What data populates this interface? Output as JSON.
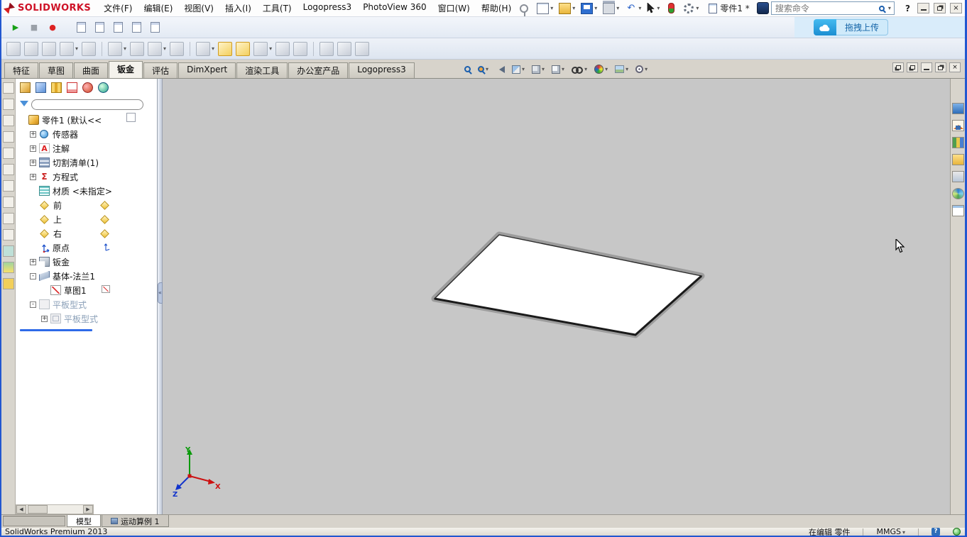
{
  "icons": {
    "dropdown": "▾",
    "help": "?",
    "close": "×",
    "play": "▶",
    "stop": "■",
    "record": "●",
    "undo": "↶",
    "scroll_left": "◀",
    "scroll_right": "▶",
    "splitter_left": "«",
    "annotation_glyph": "A",
    "sigma": "Σ"
  },
  "menubar": {
    "logo": "SOLIDWORKS",
    "menus": [
      "文件(F)",
      "编辑(E)",
      "视图(V)",
      "插入(I)",
      "工具(T)",
      "Logopress3",
      "PhotoView 360",
      "窗口(W)",
      "帮助(H)"
    ],
    "doc_title": "零件1 *",
    "search_placeholder": "搜索命令"
  },
  "macro_bar": {
    "upload_label": "拖拽上传"
  },
  "toolbar_icons": {
    "quick": [
      "new-document",
      "open-document",
      "save-document",
      "print-document",
      "undo",
      "select-cursor",
      "rebuild",
      "options"
    ],
    "macro": [
      "run-macro",
      "stop-macro",
      "record-macro",
      "new-macro",
      "edit-macro",
      "macro-tool",
      "macro-tool",
      "macro-tool"
    ],
    "heads_up": [
      "zoom-fit",
      "zoom-area",
      "previous-view",
      "section-view",
      "view-orientation",
      "display-style",
      "hide-show-items",
      "edit-appearance",
      "apply-scene",
      "view-settings"
    ],
    "task_pane": [
      "solidworks-resources",
      "design-library",
      "file-explorer",
      "view-palette",
      "appearances",
      "custom-properties",
      "document-recovery"
    ]
  },
  "command_tabs": {
    "items": [
      "特征",
      "草图",
      "曲面",
      "钣金",
      "评估",
      "DimXpert",
      "渲染工具",
      "办公室产品",
      "Logopress3"
    ],
    "active": "钣金"
  },
  "feature_tree": {
    "items": [
      {
        "label": "零件1 (默认<<",
        "expander": "",
        "icon": "part-icon",
        "muted": false
      },
      {
        "label": "传感器",
        "expander": "+",
        "icon": "sensors-icon",
        "muted": false
      },
      {
        "label": "注解",
        "expander": "+",
        "icon": "annotations-icon",
        "muted": false
      },
      {
        "label": "切割清单(1)",
        "expander": "+",
        "icon": "cut-list-icon",
        "muted": false
      },
      {
        "label": "方程式",
        "expander": "+",
        "icon": "equations-icon",
        "muted": false
      },
      {
        "label": "材质 <未指定>",
        "expander": "",
        "icon": "material-icon",
        "muted": false
      },
      {
        "label": "前",
        "expander": "",
        "icon": "plane-icon",
        "muted": false
      },
      {
        "label": "上",
        "expander": "",
        "icon": "plane-icon",
        "muted": false
      },
      {
        "label": "右",
        "expander": "",
        "icon": "plane-icon",
        "muted": false
      },
      {
        "label": "原点",
        "expander": "",
        "icon": "origin-icon",
        "muted": false
      },
      {
        "label": "钣金",
        "expander": "+",
        "icon": "sheet-metal-icon",
        "muted": false
      },
      {
        "label": "基体-法兰1",
        "expander": "-",
        "icon": "base-flange-icon",
        "muted": false
      },
      {
        "label": "草图1",
        "expander": "",
        "icon": "sketch-icon",
        "muted": false
      },
      {
        "label": "平板型式",
        "expander": "-",
        "icon": "flat-pattern-folder-icon",
        "muted": true
      },
      {
        "label": "平板型式",
        "expander": "+",
        "icon": "flat-pattern-icon",
        "muted": true
      }
    ]
  },
  "viewport": {
    "triad": {
      "x": "X",
      "y": "Y",
      "z": "Z"
    }
  },
  "bottom_tabs": {
    "items": [
      "模型",
      "运动算例 1"
    ],
    "active": "模型"
  },
  "statusbar": {
    "product": "SolidWorks Premium 2013",
    "editing": "在编辑 零件",
    "units": "MMGS"
  }
}
